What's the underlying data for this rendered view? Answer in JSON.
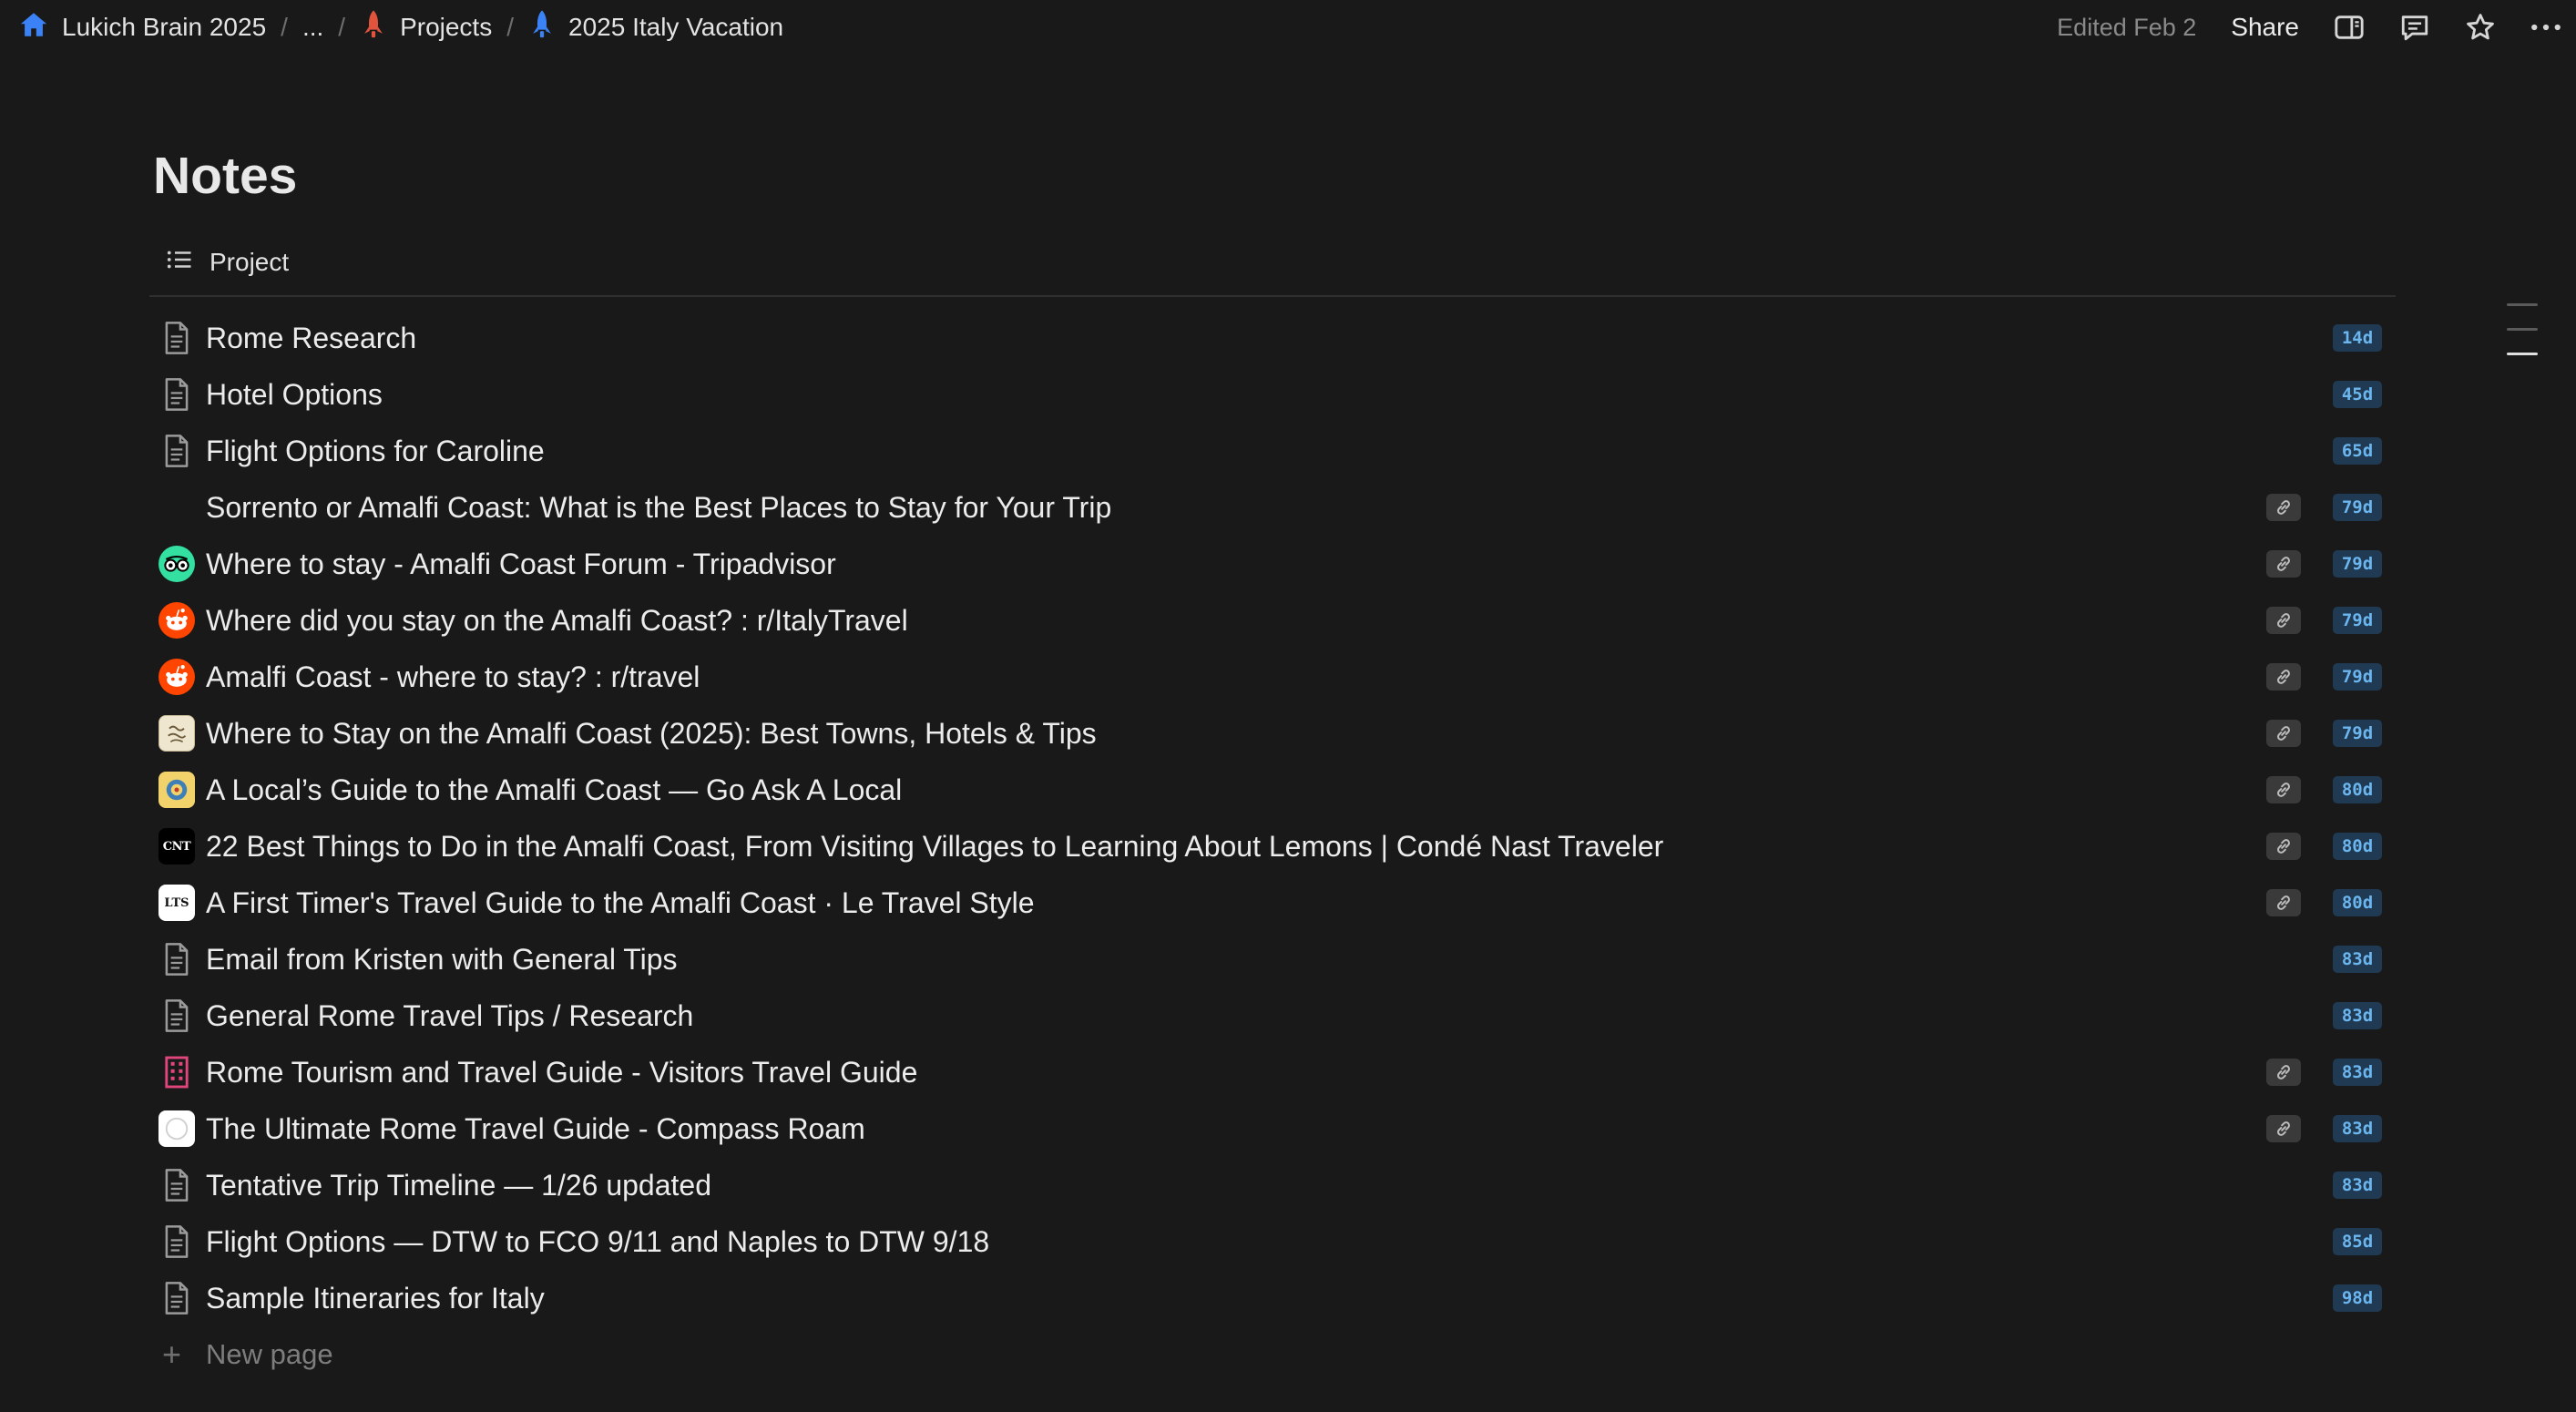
{
  "breadcrumb": {
    "workspace": "Lukich Brain 2025",
    "ellipsis": "...",
    "section": "Projects",
    "page": "2025 Italy Vacation",
    "separator": "/"
  },
  "topbar": {
    "edited": "Edited Feb 2",
    "share_label": "Share"
  },
  "page": {
    "title": "Notes",
    "view_label": "Project"
  },
  "rows": [
    {
      "label": "Rome Research",
      "age": "14d",
      "icon": "page-icon",
      "link": false
    },
    {
      "label": "Hotel Options",
      "age": "45d",
      "icon": "page-icon",
      "link": false
    },
    {
      "label": "Flight Options for Caroline",
      "age": "65d",
      "icon": "page-icon",
      "link": false
    },
    {
      "label": "Sorrento or Amalfi Coast: What is the Best Places to Stay for Your Trip",
      "age": "79d",
      "icon": "none",
      "link": true
    },
    {
      "label": "Where to stay - Amalfi Coast Forum - Tripadvisor",
      "age": "79d",
      "icon": "tripadvisor-icon",
      "link": true
    },
    {
      "label": "Where did you stay on the Amalfi Coast? : r/ItalyTravel",
      "age": "79d",
      "icon": "reddit-icon",
      "link": true
    },
    {
      "label": "Amalfi Coast - where to stay? : r/travel",
      "age": "79d",
      "icon": "reddit-icon",
      "link": true
    },
    {
      "label": "Where to Stay on the Amalfi Coast (2025): Best Towns, Hotels & Tips",
      "age": "79d",
      "icon": "site-favicon-icon",
      "link": true
    },
    {
      "label": "A Local’s Guide to the Amalfi Coast — Go Ask A Local",
      "age": "80d",
      "icon": "go-ask-a-local-icon",
      "link": true
    },
    {
      "label": "22 Best Things to Do in the Amalfi Coast, From Visiting Villages to Learning About Lemons | Condé Nast Traveler",
      "age": "80d",
      "icon": "cnt-icon",
      "link": true
    },
    {
      "label": "A First Timer's Travel Guide to the Amalfi Coast · Le Travel Style",
      "age": "80d",
      "icon": "lts-icon",
      "link": true
    },
    {
      "label": "Email from Kristen with General Tips",
      "age": "83d",
      "icon": "page-icon",
      "link": false
    },
    {
      "label": "General Rome Travel Tips / Research",
      "age": "83d",
      "icon": "page-icon",
      "link": false
    },
    {
      "label": "Rome Tourism and Travel Guide - Visitors Travel Guide",
      "age": "83d",
      "icon": "building-icon",
      "link": true
    },
    {
      "label": "The Ultimate Rome Travel Guide - Compass Roam",
      "age": "83d",
      "icon": "compass-roam-icon",
      "link": true
    },
    {
      "label": "Tentative Trip Timeline — 1/26 updated",
      "age": "83d",
      "icon": "page-icon",
      "link": false
    },
    {
      "label": "Flight Options — DTW to FCO 9/11 and Naples to DTW 9/18",
      "age": "85d",
      "icon": "page-icon",
      "link": false
    },
    {
      "label": "Sample Itineraries for Italy",
      "age": "98d",
      "icon": "page-icon",
      "link": false
    }
  ],
  "favicon_text": {
    "cnt": "CNT",
    "lts": "LTS"
  },
  "new_page": {
    "label": "New page"
  },
  "colors": {
    "background": "#191919",
    "age_badge_bg": "#1f3a52",
    "age_badge_text": "#6cb6f0",
    "home_icon": "#3b82f6",
    "projects_icon": "#e0533d",
    "vacation_icon": "#3b82f6",
    "reddit": "#ff4500",
    "tripadvisor": "#34e0a1"
  }
}
